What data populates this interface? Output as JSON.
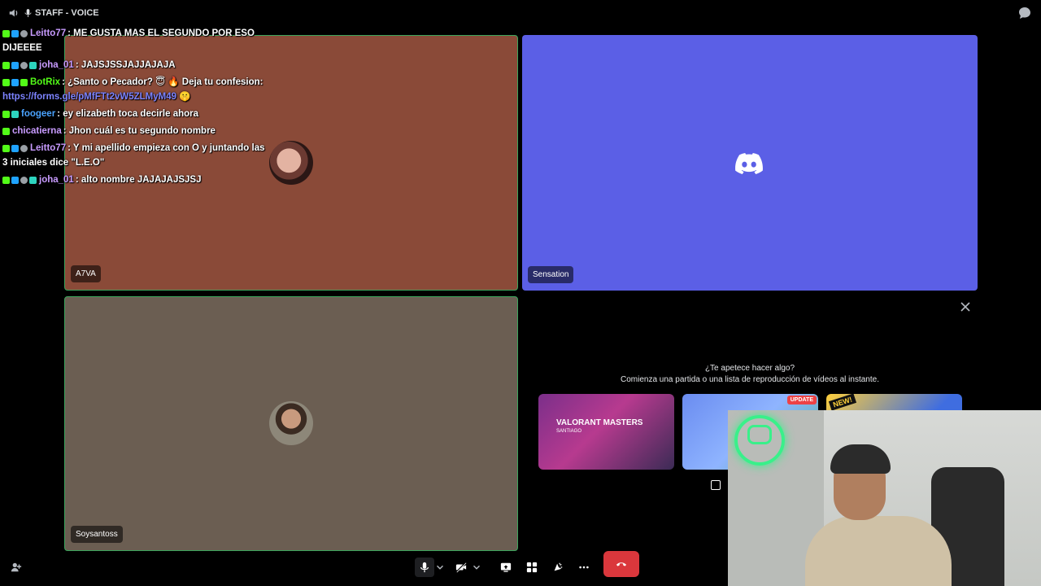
{
  "topbar": {
    "title": "STAFF - VOICE",
    "icons": [
      "speaker-icon",
      "mic-icon",
      "chat-icon"
    ]
  },
  "tiles": [
    {
      "name": "A7VA",
      "bg": "#8a4a38",
      "speaking": true
    },
    {
      "name": "Sensation",
      "bg": "#5b5fe6",
      "speaking": false
    },
    {
      "name": "Soysantoss",
      "bg": "#6b5e52",
      "speaking": true
    }
  ],
  "activity": {
    "title": "¿Te apetece hacer algo?",
    "subtitle": "Comienza una partida o una lista de reproducción de vídeos al instante.",
    "cards": [
      {
        "title": "VALORANT MASTERS",
        "subtitle": "SANTIAGO"
      },
      {
        "badge": "UPDATE"
      },
      {
        "tag": "NEW!"
      }
    ]
  },
  "chat": [
    {
      "user": "Leitto77",
      "color": "#c89bff",
      "text": ": ME GUSTA MAS EL SEGUNDO POR ESO DIJEEEE"
    },
    {
      "user": "joha_01",
      "color": "#c89bff",
      "text": ": JAJSJSSJAJJAJAJA"
    },
    {
      "user": "BotRix",
      "color": "#53fc18",
      "text": ": ¿Santo o Pecador? 😇 🔥 Deja tu confesion: ",
      "link": "https://forms.gle/pMfFTt2vW5ZLMyM49",
      "suffix": " 🤫"
    },
    {
      "user": "foogeer",
      "color": "#4aa3ff",
      "text": ": ey elizabeth toca decirle ahora"
    },
    {
      "user": "chicatierna",
      "color": "#c89bff",
      "text": ": Jhon cuál es tu segundo nombre"
    },
    {
      "user": "Leitto77",
      "color": "#c89bff",
      "text": ": Y mi apellido empieza con O y juntando las 3 iniciales dice \"L.E.O\""
    },
    {
      "user": "joha_01",
      "color": "#c89bff",
      "text": ": alto nombre JAJAJAJSJSJ"
    }
  ],
  "colors": {
    "speaking": "#3ba55c",
    "hangup": "#da373c",
    "brand": "#5b5fe6"
  }
}
